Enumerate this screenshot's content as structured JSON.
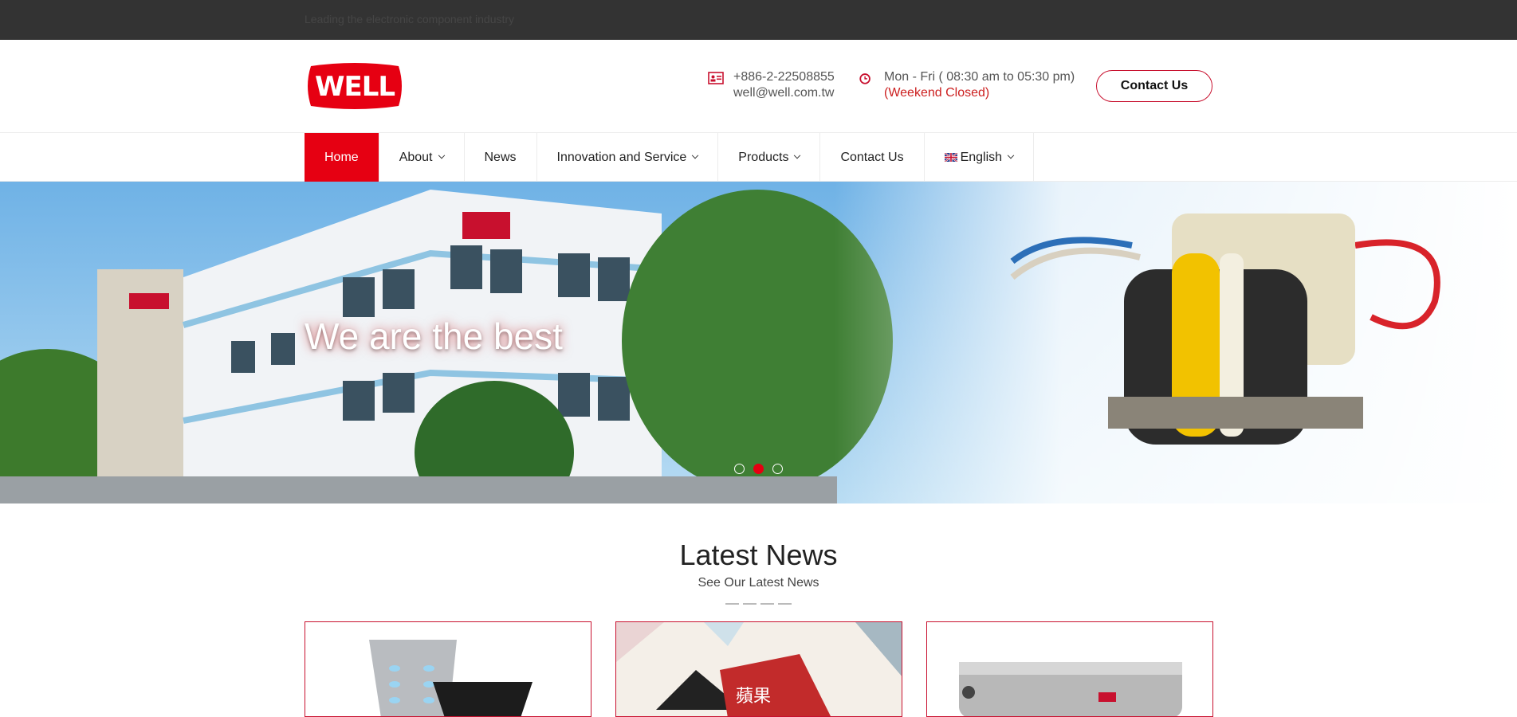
{
  "topbar": {
    "tagline": "Leading the electronic component industry"
  },
  "header": {
    "logo_text": "WELL",
    "phone": "+886-2-22508855",
    "email": "well@well.com.tw",
    "hours": "Mon - Fri ( 08:30 am to 05:30 pm)",
    "weekend": "(Weekend Closed)",
    "contact_button": "Contact Us"
  },
  "nav": {
    "items": [
      {
        "label": "Home",
        "active": true,
        "dropdown": false
      },
      {
        "label": "About",
        "dropdown": true
      },
      {
        "label": "News",
        "dropdown": false
      },
      {
        "label": "Innovation and Service",
        "dropdown": true
      },
      {
        "label": "Products",
        "dropdown": true
      },
      {
        "label": "Contact Us",
        "dropdown": false
      },
      {
        "label": "English",
        "dropdown": true
      }
    ]
  },
  "hero": {
    "title": "We are the best",
    "slides": 3,
    "active_slide": 2
  },
  "news": {
    "title": "Latest News",
    "subtitle": "See Our Latest News"
  },
  "colors": {
    "brand_red": "#e60012",
    "topbar_bg": "#333333",
    "border_red": "#c8102e"
  }
}
